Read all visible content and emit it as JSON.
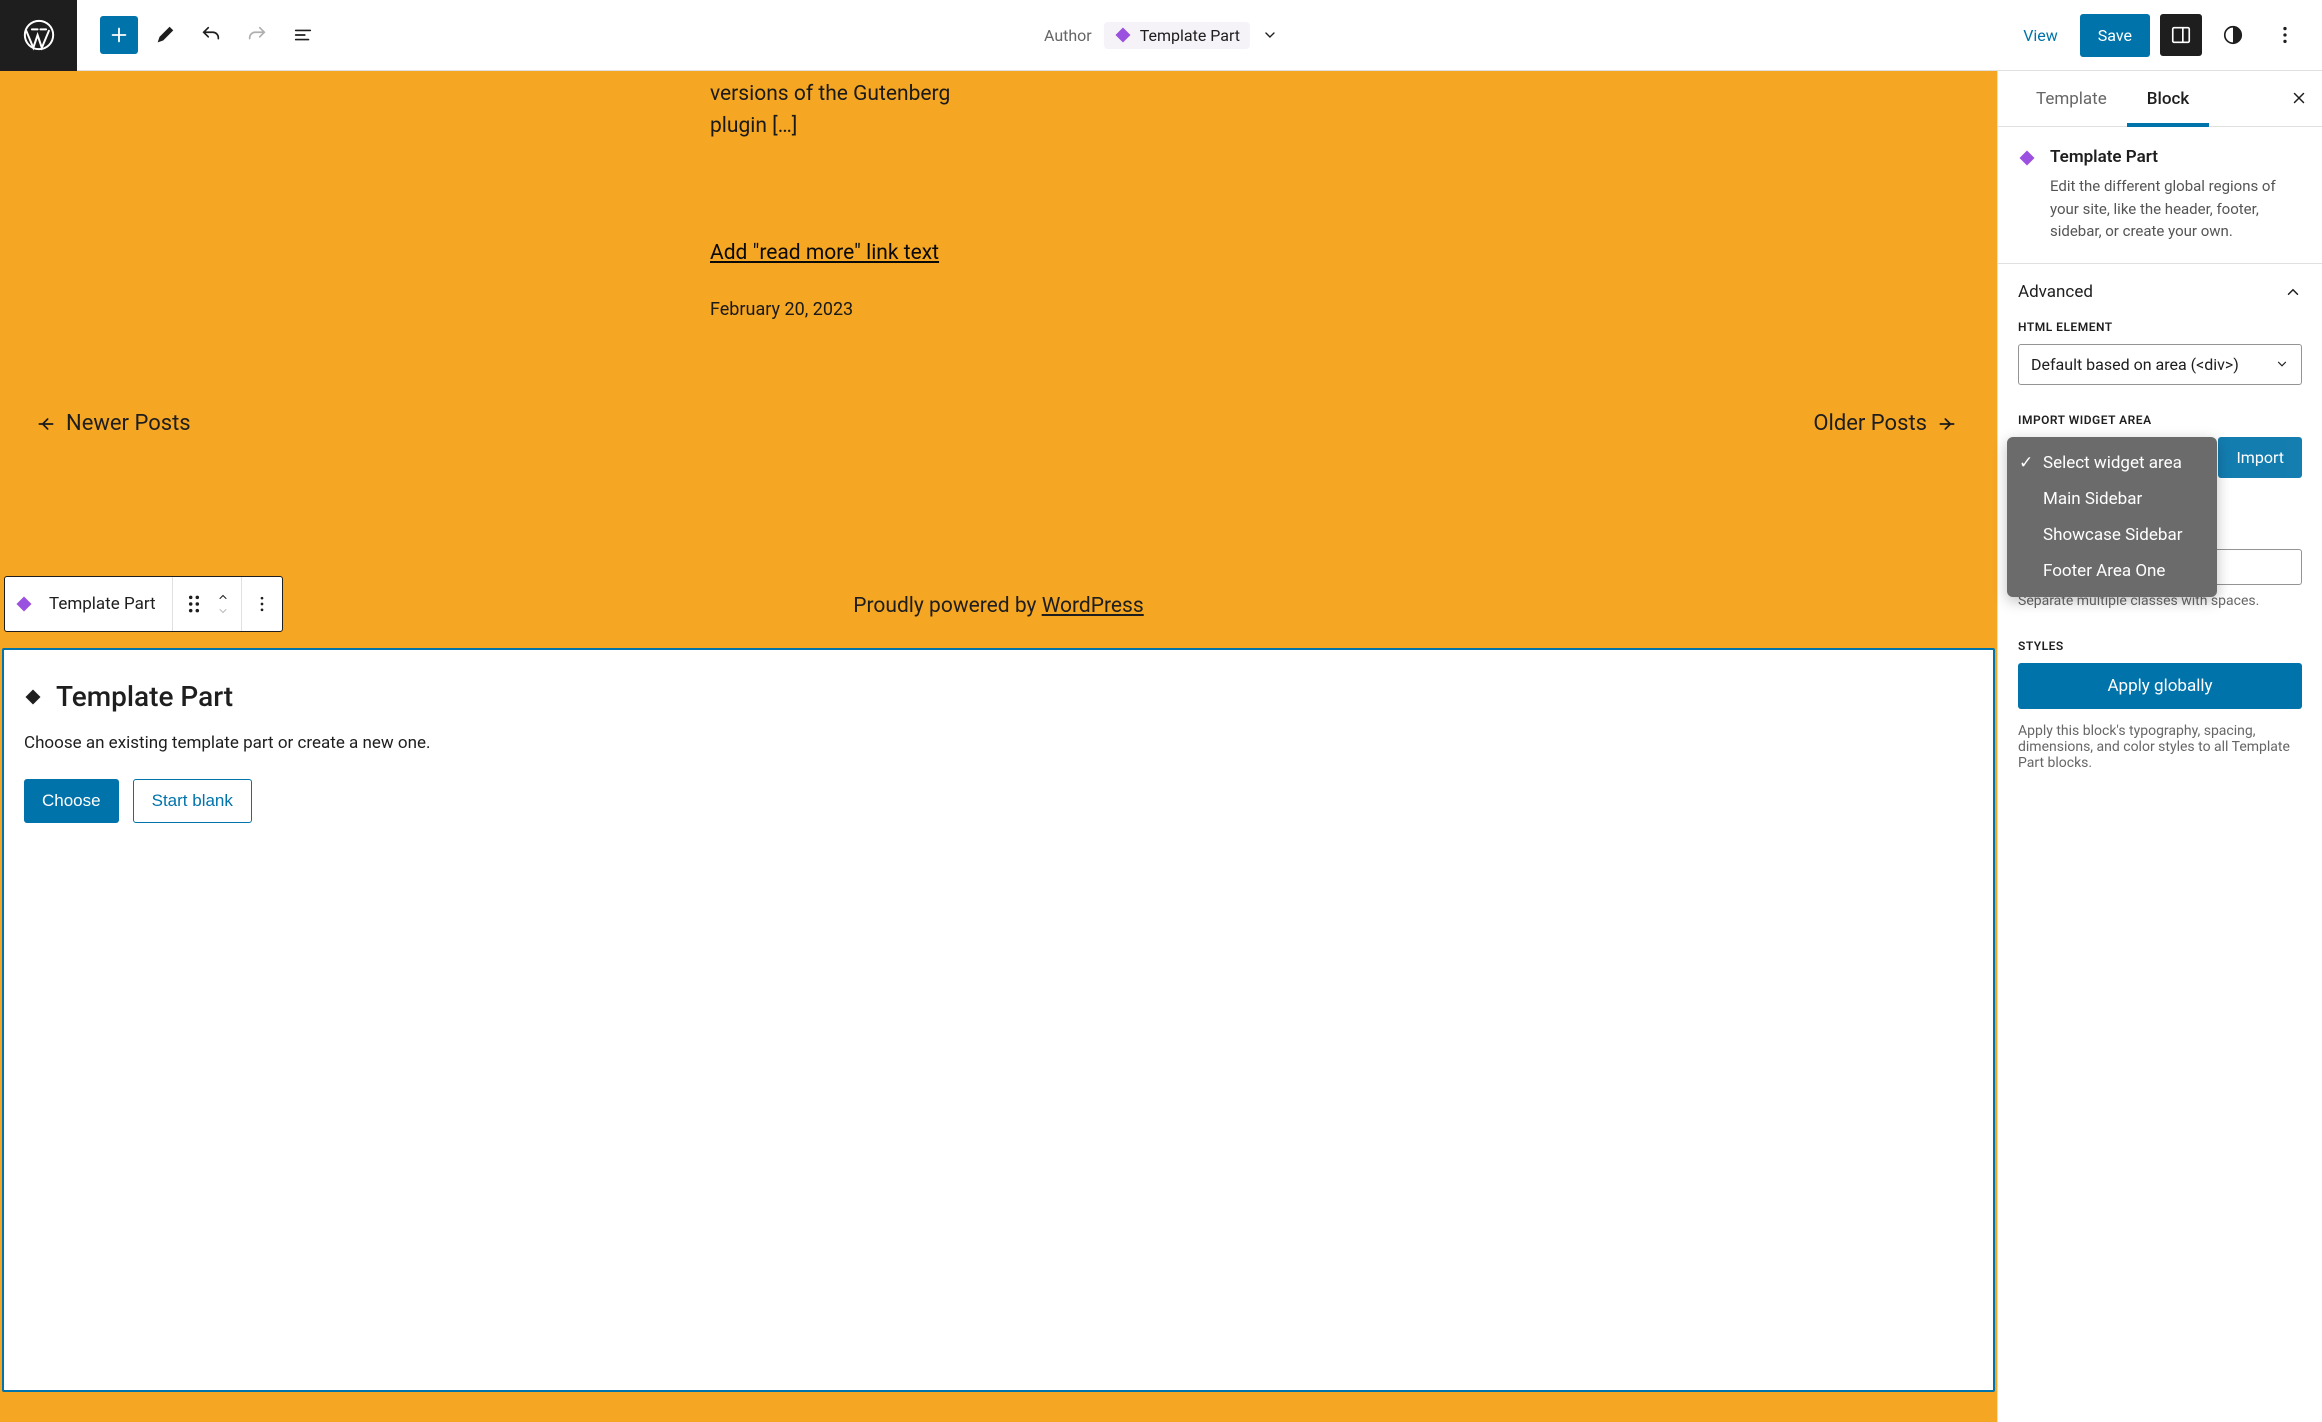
{
  "topbar": {
    "author_label": "Author",
    "template_part_label": "Template Part",
    "view": "View",
    "save": "Save"
  },
  "canvas": {
    "excerpt": "versions of the Gutenberg plugin […]",
    "read_more": "Add \"read more\" link text",
    "post_date": "February 20, 2023",
    "newer": "Newer Posts",
    "older": "Older Posts",
    "powered_prefix": "Proudly powered by ",
    "powered_link": "WordPress"
  },
  "block_toolbar": {
    "label": "Template Part"
  },
  "placeholder": {
    "title": "Template Part",
    "description": "Choose an existing template part or create a new one.",
    "choose": "Choose",
    "start_blank": "Start blank"
  },
  "sidebar": {
    "tabs": {
      "template": "Template",
      "block": "Block"
    },
    "block_info": {
      "title": "Template Part",
      "description": "Edit the different global regions of your site, like the header, footer, sidebar, or create your own."
    },
    "advanced": {
      "heading": "Advanced",
      "html_element_label": "HTML ELEMENT",
      "html_element_value": "Default based on area (<div>)",
      "import_label": "IMPORT WIDGET AREA",
      "import_button": "Import",
      "dropdown_options": [
        "Select widget area",
        "Main Sidebar",
        "Showcase Sidebar",
        "Footer Area One"
      ],
      "css_help": "Separate multiple classes with spaces.",
      "styles_label": "STYLES",
      "apply_globally": "Apply globally",
      "apply_help": "Apply this block's typography, spacing, dimensions, and color styles to all Template Part blocks."
    }
  }
}
